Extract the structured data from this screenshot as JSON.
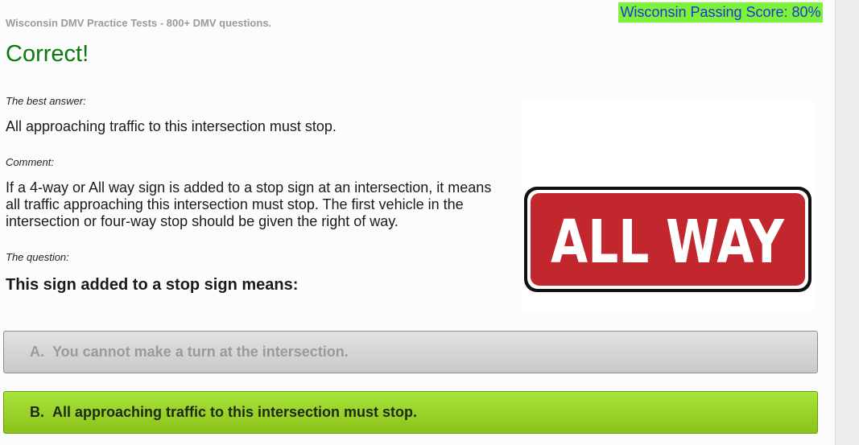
{
  "header": {
    "site_title": "Wisconsin DMV Practice Tests - 800+ DMV questions.",
    "passing_score": "Wisconsin Passing Score: 80%"
  },
  "result": {
    "heading": "Correct!"
  },
  "best_answer": {
    "label": "The best answer:",
    "text": "All approaching traffic to this intersection must stop."
  },
  "comment": {
    "label": "Comment:",
    "text": "If a 4-way or All way sign is added to a stop sign at an intersection, it means all traffic approaching this intersection must stop. The first vehicle in the intersection or four-way stop should be given the right of way."
  },
  "question": {
    "label": "The question:",
    "text": "This sign added to a stop sign means:"
  },
  "sign_image": {
    "text": "ALL WAY",
    "color": "#c1272d"
  },
  "answers": [
    {
      "letter": "A.",
      "text": "You cannot make a turn at the intersection.",
      "state": "incorrect"
    },
    {
      "letter": "B.",
      "text": "All approaching traffic to this intersection must stop.",
      "state": "correct"
    }
  ],
  "colors": {
    "passing_score_bg": "#7cf23a",
    "passing_score_text": "#2334d6",
    "correct_heading": "#0d7a0d",
    "correct_answer_bg": "#9ad42a",
    "sign_red": "#c1272d"
  }
}
